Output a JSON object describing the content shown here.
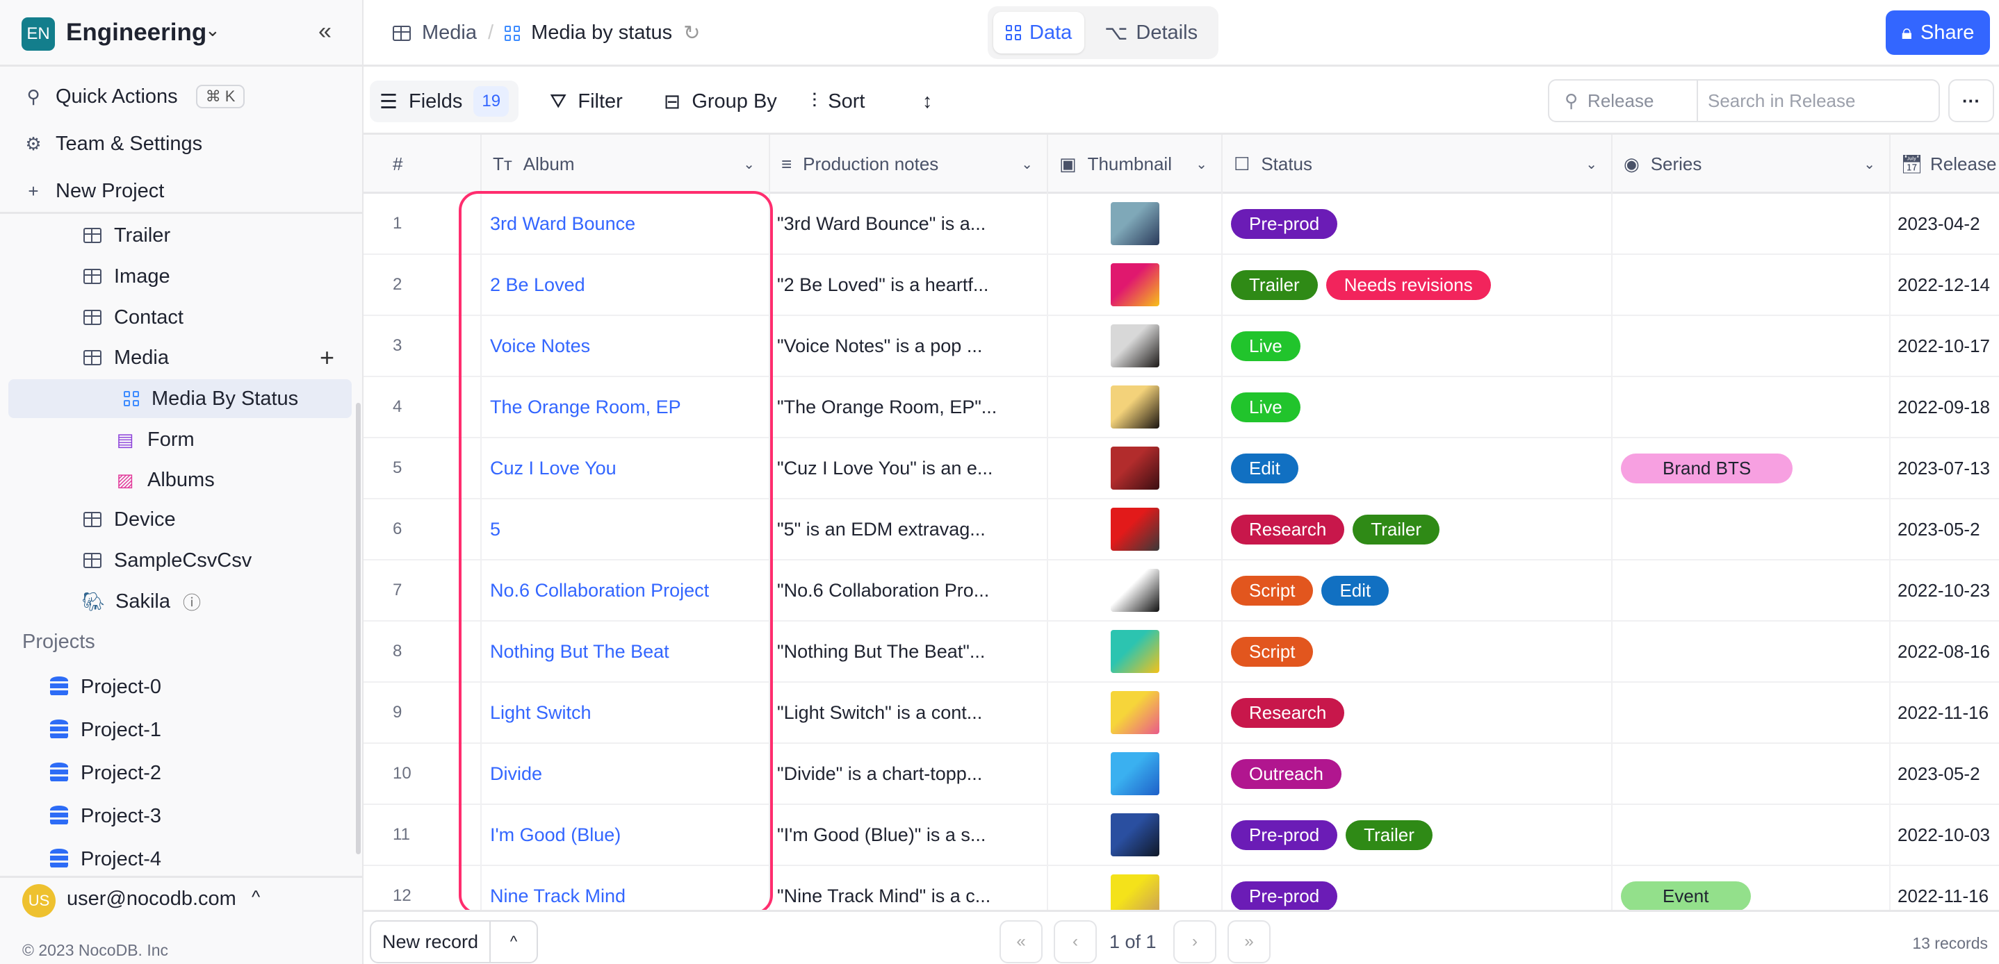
{
  "workspace": {
    "badge": "EN",
    "name": "Engineering"
  },
  "sidebar": {
    "quick_actions": "Quick Actions",
    "shortcut": "⌘ K",
    "team_settings": "Team & Settings",
    "new_project": "New Project",
    "tables": [
      {
        "label": "Trailer",
        "icon": "table-icon"
      },
      {
        "label": "Image",
        "icon": "table-icon"
      },
      {
        "label": "Contact",
        "icon": "table-icon"
      },
      {
        "label": "Media",
        "icon": "table-icon"
      },
      {
        "label": "Media By Status",
        "icon": "grid-view-icon",
        "selected": true
      },
      {
        "label": "Form",
        "icon": "form-view-icon"
      },
      {
        "label": "Albums",
        "icon": "gallery-view-icon"
      },
      {
        "label": "Device",
        "icon": "table-icon"
      },
      {
        "label": "SampleCsvCsv",
        "icon": "table-icon"
      },
      {
        "label": "Sakila",
        "icon": "postgres-icon"
      }
    ],
    "projects_heading": "Projects",
    "projects": [
      "Project-0",
      "Project-1",
      "Project-2",
      "Project-3",
      "Project-4"
    ],
    "user_initials": "US",
    "user_email": "user@nocodb.com",
    "copyright": "© 2023 NocoDB. Inc"
  },
  "header": {
    "crumb_table": "Media",
    "crumb_view": "Media by status",
    "tab_data": "Data",
    "tab_details": "Details",
    "share": "Share"
  },
  "toolbar": {
    "fields": "Fields",
    "fields_count": "19",
    "filter": "Filter",
    "group_by": "Group By",
    "sort": "Sort",
    "search_field": "Release",
    "search_placeholder": "Search in Release"
  },
  "columns": {
    "num": "#",
    "album": "Album",
    "notes": "Production notes",
    "thumbnail": "Thumbnail",
    "status": "Status",
    "series": "Series",
    "release": "Release"
  },
  "tag_colors": {
    "Pre-prod": "#6b1cb6",
    "Trailer": "#2f8a16",
    "Needs revisions": "#f2245c",
    "Live": "#21c42c",
    "Edit": "#1170c2",
    "Research": "#c8174b",
    "Script": "#e2561e",
    "Outreach": "#b1168f",
    "Brand BTS": "#f7a0e1",
    "Event": "#93e08b"
  },
  "rows": [
    {
      "n": "1",
      "album": "3rd Ward Bounce",
      "notes": "\"3rd Ward Bounce\" is a...",
      "thumb": [
        "#7fa8b8",
        "#2a3a5a"
      ],
      "status": [
        "Pre-prod"
      ],
      "series": [],
      "release": "2023-04-2"
    },
    {
      "n": "2",
      "album": "2 Be Loved",
      "notes": "\"2 Be Loved\" is a heartf...",
      "thumb": [
        "#e0186e",
        "#f7c11a"
      ],
      "status": [
        "Trailer",
        "Needs revisions"
      ],
      "series": [],
      "release": "2022-12-14"
    },
    {
      "n": "3",
      "album": "Voice Notes",
      "notes": "\"Voice Notes\" is a pop ...",
      "thumb": [
        "#d8d8d8",
        "#1d1a18"
      ],
      "status": [
        "Live"
      ],
      "series": [],
      "release": "2022-10-17"
    },
    {
      "n": "4",
      "album": "The Orange Room, EP",
      "notes": "\"The Orange Room, EP\"...",
      "thumb": [
        "#f3d27a",
        "#1a1410"
      ],
      "status": [
        "Live"
      ],
      "series": [],
      "release": "2022-09-18"
    },
    {
      "n": "5",
      "album": "Cuz I Love You",
      "notes": "\"Cuz I Love You\" is an e...",
      "thumb": [
        "#b22c2c",
        "#3a0e12"
      ],
      "status": [
        "Edit"
      ],
      "series": [
        "Brand BTS"
      ],
      "release": "2023-07-13"
    },
    {
      "n": "6",
      "album": "5",
      "notes": "\"5\" is an EDM extravag...",
      "thumb": [
        "#e21a1a",
        "#3a3a3a"
      ],
      "status": [
        "Research",
        "Trailer"
      ],
      "series": [],
      "release": "2023-05-2"
    },
    {
      "n": "7",
      "album": "No.6 Collaboration Project",
      "notes": "\"No.6 Collaboration Pro...",
      "thumb": [
        "#ffffff",
        "#111111"
      ],
      "status": [
        "Script",
        "Edit"
      ],
      "series": [],
      "release": "2022-10-23"
    },
    {
      "n": "8",
      "album": "Nothing But The Beat",
      "notes": "\"Nothing But The Beat\"...",
      "thumb": [
        "#2cc4b0",
        "#f4c21a"
      ],
      "status": [
        "Script"
      ],
      "series": [],
      "release": "2022-08-16"
    },
    {
      "n": "9",
      "album": "Light Switch",
      "notes": "\"Light Switch\" is a cont...",
      "thumb": [
        "#f6d53a",
        "#e95a8a"
      ],
      "status": [
        "Research"
      ],
      "series": [],
      "release": "2022-11-16"
    },
    {
      "n": "10",
      "album": "Divide",
      "notes": "\"Divide\" is a chart-topp...",
      "thumb": [
        "#3ab0f0",
        "#1e5fc8"
      ],
      "status": [
        "Outreach"
      ],
      "series": [],
      "release": "2023-05-2"
    },
    {
      "n": "11",
      "album": "I'm Good (Blue)",
      "notes": "\"I'm Good (Blue)\" is a s...",
      "thumb": [
        "#2a4fa0",
        "#101828"
      ],
      "status": [
        "Pre-prod",
        "Trailer"
      ],
      "series": [],
      "release": "2022-10-03"
    },
    {
      "n": "12",
      "album": "Nine Track Mind",
      "notes": "\"Nine Track Mind\" is a c...",
      "thumb": [
        "#f4e21a",
        "#c89a5a"
      ],
      "status": [
        "Pre-prod"
      ],
      "series": [
        "Event"
      ],
      "release": "2022-11-16"
    }
  ],
  "footer": {
    "new_record": "New record",
    "page": "1 of 1",
    "records": "13 records"
  }
}
